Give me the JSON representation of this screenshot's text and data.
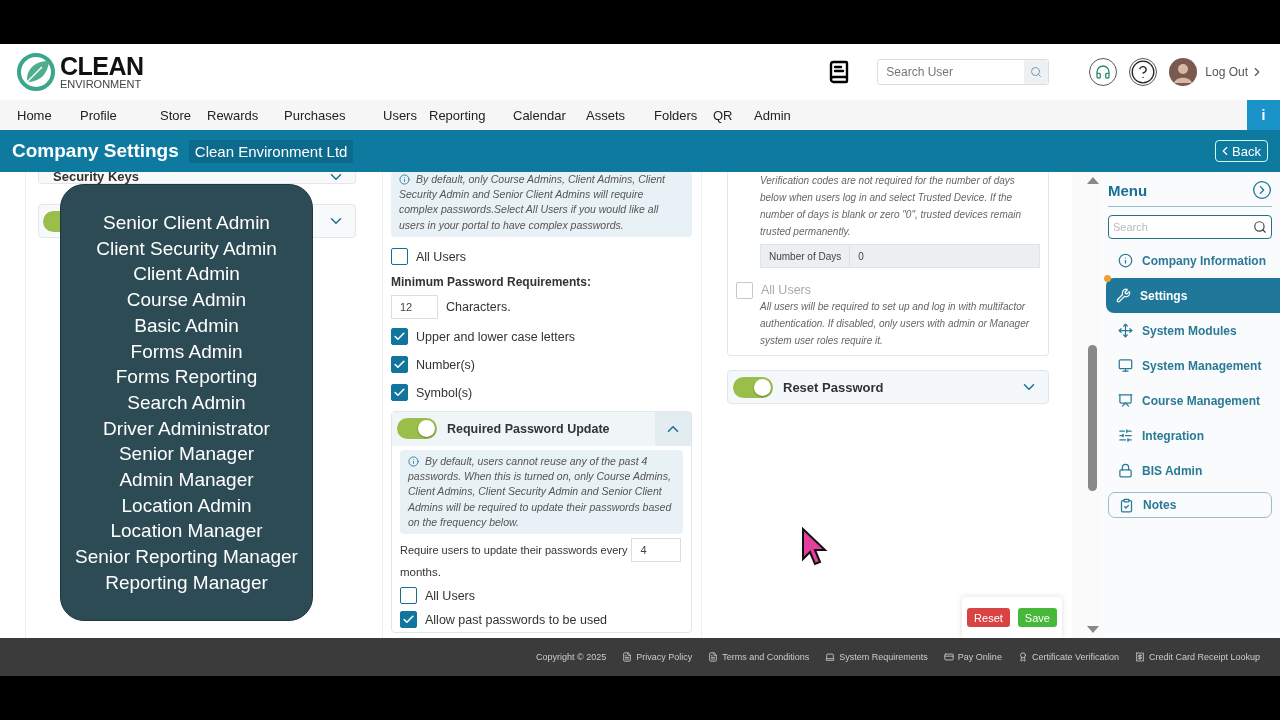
{
  "header": {
    "logo": {
      "title": "CLEAN",
      "subtitle": "ENVIRONMENT"
    },
    "search": {
      "placeholder": "Search User"
    },
    "logout": "Log Out"
  },
  "nav": {
    "items": [
      "Home",
      "Profile",
      "Store",
      "Rewards",
      "Purchases",
      "Users",
      "Reporting",
      "Calendar",
      "Assets",
      "Folders",
      "QR",
      "Admin"
    ],
    "info_button": "i"
  },
  "title_bar": {
    "title": "Company Settings",
    "company": "Clean Environment Ltd",
    "back": "Back"
  },
  "left_column": {
    "panels": [
      {
        "kind": "plain",
        "label": "Security Keys",
        "expanded": false
      },
      {
        "kind": "toggle",
        "on": true,
        "expanded": false
      }
    ]
  },
  "role_list": [
    "Senior Client Admin",
    "Client Security Admin",
    "Client Admin",
    "Course Admin",
    "Basic Admin",
    "Forms Admin",
    "Forms Reporting",
    "Search Admin",
    "Driver Administrator",
    "Senior Manager",
    "Admin Manager",
    "Location Admin",
    "Location Manager",
    "Senior Reporting Manager",
    "Reporting Manager"
  ],
  "password_column": {
    "info": "By default, only Course Admins, Client Admins, Client Security Admin and Senior Client Admins will require complex passwords.Select All Users if you would like all users in your portal to have complex passwords.",
    "all_users": {
      "label": "All Users",
      "checked": false
    },
    "requirements_heading": "Minimum Password Requirements:",
    "min_length": {
      "value": "12",
      "suffix": "Characters."
    },
    "requirements": [
      {
        "label": "Upper and lower case letters",
        "checked": true
      },
      {
        "label": "Number(s)",
        "checked": true
      },
      {
        "label": "Symbol(s)",
        "checked": true
      }
    ],
    "update_panel": {
      "label": "Required Password Update",
      "on": true,
      "expanded": true,
      "info": "By default, users cannot reuse any of the past 4 passwords. When this is turned on, only Course Admins, Client Admins, Client Security Admin and Senior Client Admins will be required to update their passwords based on the frequency below.",
      "frequency_label": "Require users to update their passwords every",
      "frequency_value": "4",
      "frequency_unit": "months.",
      "options": [
        {
          "label": "All Users",
          "checked": false
        },
        {
          "label": "Allow past passwords to be used",
          "checked": true
        }
      ]
    }
  },
  "mfa_column": {
    "info": "Verification codes are not required for the number of days below when users log in and select Trusted Device. If the number of days is blank or zero \"0\", trusted devices remain trusted permanently.",
    "days": {
      "label": "Number of Days",
      "value": "0"
    },
    "all_users": {
      "label": "All Users",
      "checked": false,
      "disabled": true
    },
    "all_users_note": "All users will be required to set up and log in with multifactor authentication. If disabled, only users with admin or Manager system user roles require it.",
    "reset_panel": {
      "label": "Reset Password",
      "on": true,
      "expanded": false
    }
  },
  "actions": [
    "Reset",
    "Save"
  ],
  "menu": {
    "title": "Menu",
    "search": {
      "placeholder": "Search"
    },
    "items": [
      {
        "label": "Company Information",
        "selected": false,
        "kind": "link"
      },
      {
        "label": "Settings",
        "selected": true,
        "kind": "link"
      },
      {
        "label": "System Modules",
        "selected": false,
        "kind": "link"
      },
      {
        "label": "System Management",
        "selected": false,
        "kind": "link"
      },
      {
        "label": "Course Management",
        "selected": false,
        "kind": "link"
      },
      {
        "label": "Integration",
        "selected": false,
        "kind": "link"
      },
      {
        "label": "BIS Admin",
        "selected": false,
        "kind": "link"
      },
      {
        "label": "Notes",
        "selected": false,
        "kind": "boxed"
      }
    ]
  },
  "footer": {
    "copyright": "Copyright © 2025",
    "links": [
      "Privacy Policy",
      "Terms and Conditions",
      "System Requirements",
      "Pay Online",
      "Certificate Verification",
      "Credit Card Receipt Lookup"
    ]
  }
}
